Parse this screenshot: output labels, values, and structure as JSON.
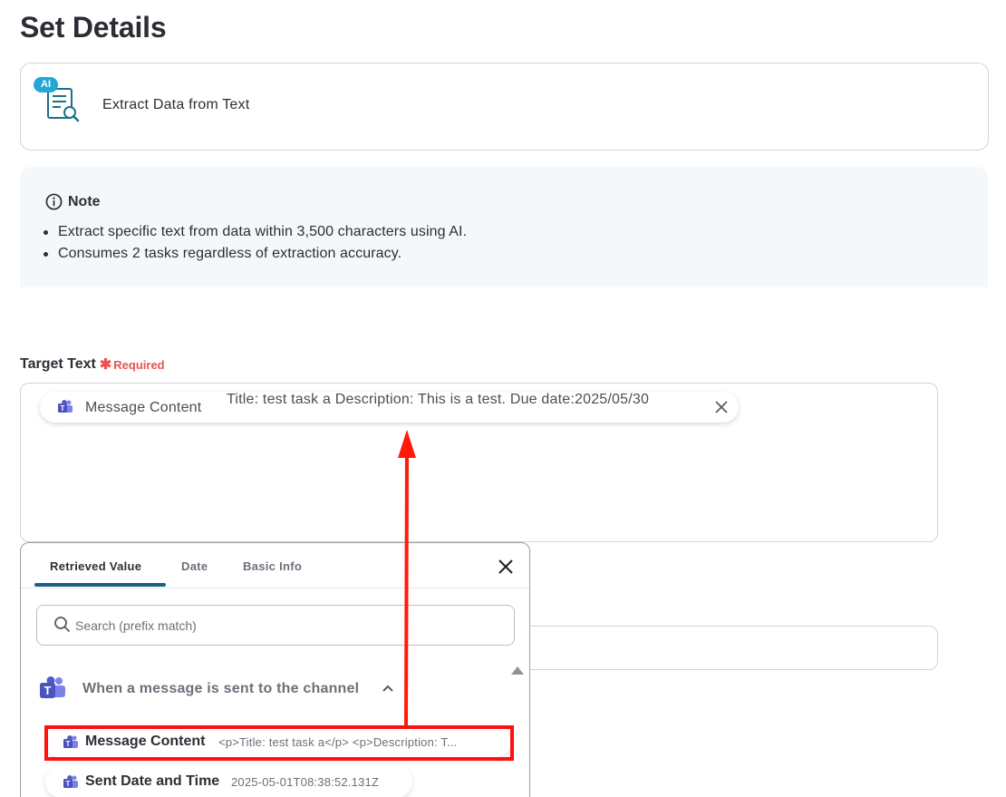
{
  "page": {
    "title": "Set Details"
  },
  "operation": {
    "badge": "AI",
    "label": "Extract Data from Text"
  },
  "note": {
    "title": "Note",
    "items": [
      "Extract specific text from data within 3,500 characters using AI.",
      "Consumes 2 tasks regardless of extraction accuracy."
    ]
  },
  "target_text": {
    "label": "Target Text",
    "required_star": "✱",
    "required_label": "Required",
    "chip": {
      "name": "Message Content",
      "value": "Title: test task a  Description: This is a test.  Due date:2025/05/30"
    }
  },
  "popover": {
    "tabs": [
      {
        "label": "Retrieved Value",
        "active": true
      },
      {
        "label": "Date",
        "active": false
      },
      {
        "label": "Basic Info",
        "active": false
      }
    ],
    "search_placeholder": "Search (prefix match)",
    "group": {
      "label": "When a message is sent to the channel",
      "expanded": true
    },
    "items": [
      {
        "name": "Message Content",
        "value": "<p>Title: test task a</p> <p>Description: T...",
        "highlighted": true
      },
      {
        "name": "Sent Date and Time",
        "value": "2025-05-01T08:38:52.131Z",
        "highlighted": false
      }
    ]
  },
  "colors": {
    "accent": "#1a5f86",
    "required": "#e8534f",
    "highlight": "#ff0f0f",
    "teams": "#5059c9"
  }
}
